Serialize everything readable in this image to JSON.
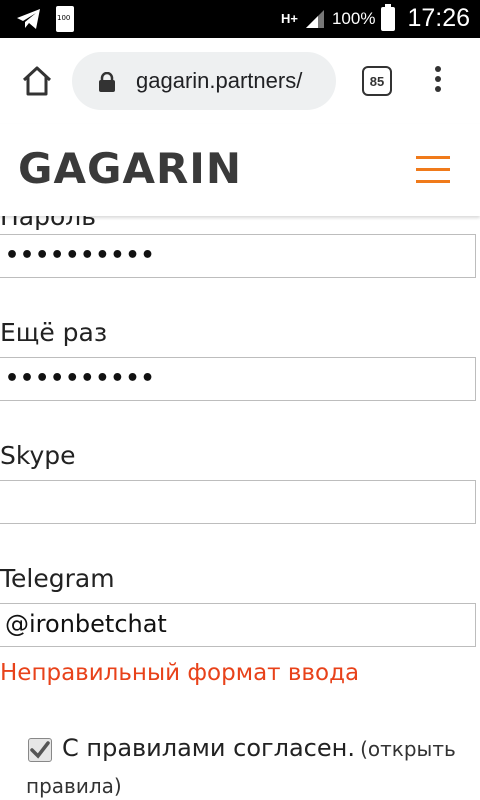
{
  "status_bar": {
    "battery_percent": "100%",
    "time": "17:26",
    "network_label": "H+",
    "sim_badge": "100",
    "icons": [
      "telegram-icon",
      "sim-card-icon",
      "signal-icon",
      "battery-icon"
    ]
  },
  "browser": {
    "url": "gagarin.partners/",
    "tab_count": "85",
    "icons": [
      "home-icon",
      "lock-icon",
      "menu-dots-icon"
    ]
  },
  "site": {
    "logo": "GAGARIN",
    "accent_color": "#f07a1a",
    "icons": [
      "hamburger-menu-icon"
    ]
  },
  "form": {
    "password_label": "Пароль",
    "password_value": "••••••••••",
    "password_repeat_label": "Ещё раз",
    "password_repeat_value": "••••••••••",
    "skype_label": "Skype",
    "skype_value": "",
    "telegram_label": "Telegram",
    "telegram_value": "@ironbetchat",
    "telegram_error": "Неправильный формат ввода",
    "error_color": "#e8421a",
    "agree_checked": true,
    "agree_text": "С правилами согласен.",
    "agree_link_part1": "(открыть",
    "agree_link_part2": "правила)"
  }
}
